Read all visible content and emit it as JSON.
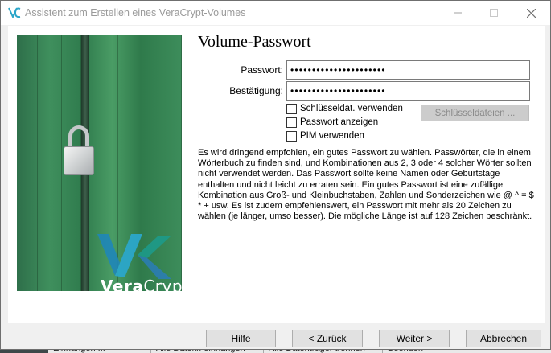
{
  "window": {
    "title": "Assistent zum Erstellen eines VeraCrypt-Volumes"
  },
  "brand": {
    "logo_text_bold": "Vera",
    "logo_text_thin": "Crypt"
  },
  "page": {
    "heading": "Volume-Passwort",
    "password_label": "Passwort:",
    "password_value": "••••••••••••••••••••••",
    "confirm_label": "Bestätigung:",
    "confirm_value": "••••••••••••••••••••••",
    "options": [
      {
        "label": "Schlüsseldat. verwenden",
        "checked": false
      },
      {
        "label": "Passwort anzeigen",
        "checked": false
      },
      {
        "label": "PIM verwenden",
        "checked": false
      }
    ],
    "keyfiles_button": "Schlüsseldateien ...",
    "info_text": "Es wird dringend empfohlen, ein gutes Passwort zu wählen. Passwörter, die in einem Wörterbuch zu finden sind, und Kombinationen aus 2, 3 oder 4 solcher Wörter sollten nicht verwendet werden. Das Passwort sollte keine Namen oder Geburtstage enthalten und nicht leicht zu erraten sein. Ein gutes Passwort ist eine zufällige Kombination aus Groß- und Kleinbuchstaben, Zahlen und Sonderzeichen wie @ ^ = $ * + usw. Es ist zudem empfehlenswert, ein Passwort mit mehr als 20 Zeichen zu wählen (je länger, umso besser). Die mögliche Länge ist auf 128 Zeichen beschränkt."
  },
  "footer": {
    "help": "Hilfe",
    "back": "< Zurück",
    "next": "Weiter >",
    "cancel": "Abbrechen"
  },
  "background_window": {
    "items": [
      "Einhängen ...",
      "Alle Dateitr. einhängen",
      "Alle Datenträger trennen",
      "Beenden"
    ]
  },
  "colors": {
    "accent_logo": "#2ba6c9",
    "image_green": "#3f8f5d"
  }
}
